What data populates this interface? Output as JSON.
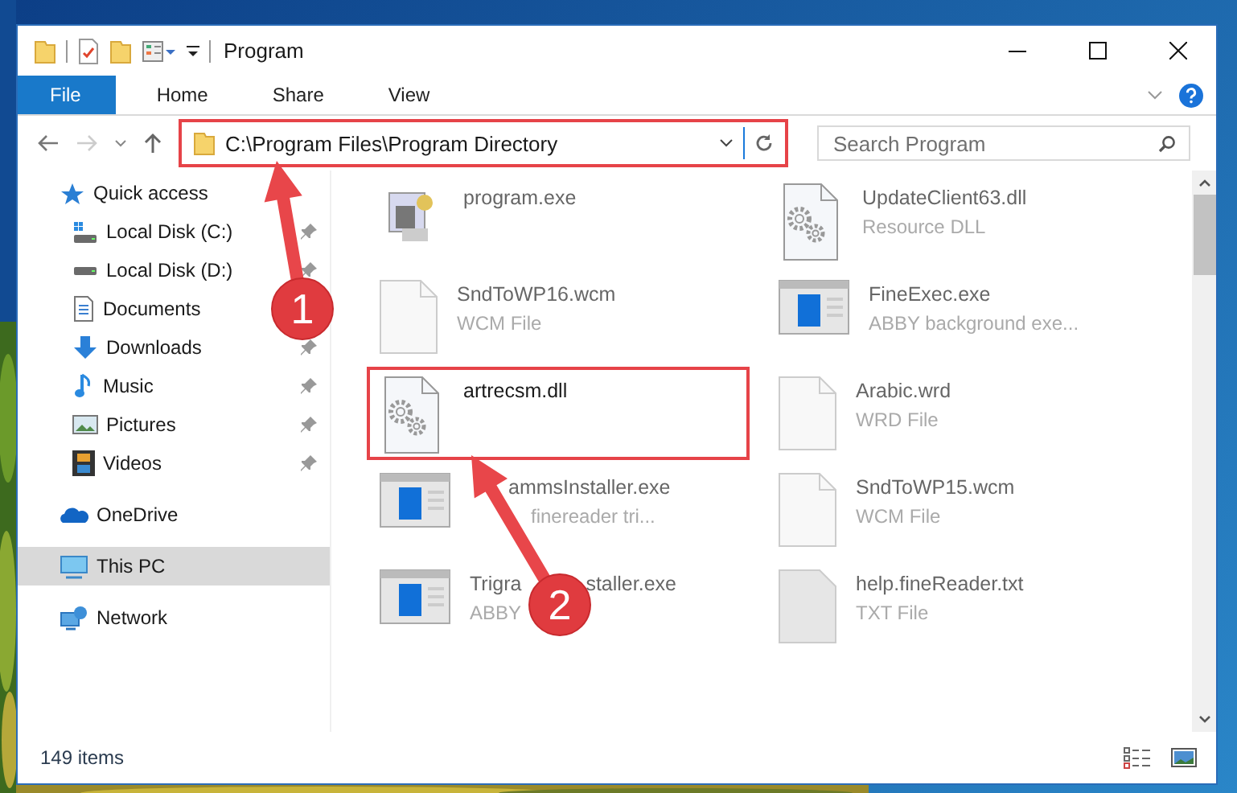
{
  "window": {
    "title": "Program"
  },
  "ribbon_tabs": [
    {
      "label": "File",
      "kind": "file",
      "selected": false
    },
    {
      "label": "Home",
      "kind": "tab",
      "selected": false
    },
    {
      "label": "Share",
      "kind": "tab",
      "selected": false
    },
    {
      "label": "View",
      "kind": "tab",
      "selected": false
    }
  ],
  "address": {
    "path": "C:\\Program Files\\Program Directory",
    "highlighted": true
  },
  "search": {
    "placeholder": "Search Program"
  },
  "sidebar": {
    "items": [
      {
        "label": "Quick access",
        "kind": "star",
        "selected": false,
        "children": [
          {
            "label": "Local Disk (C:)",
            "kind": "systemdrive",
            "pinned": true
          },
          {
            "label": "Local Disk (D:)",
            "kind": "drive",
            "pinned": true
          },
          {
            "label": "Documents",
            "kind": "document"
          },
          {
            "label": "Downloads",
            "kind": "download",
            "pinned": true
          },
          {
            "label": "Music",
            "kind": "music",
            "pinned": true
          },
          {
            "label": "Pictures",
            "kind": "pictures",
            "pinned": true
          },
          {
            "label": "Videos",
            "kind": "video",
            "pinned": true
          }
        ]
      },
      {
        "label": "OneDrive",
        "kind": "cloud",
        "selected": false
      },
      {
        "label": "This PC",
        "kind": "pc",
        "selected": true
      },
      {
        "label": "Network",
        "kind": "network",
        "selected": false
      }
    ]
  },
  "files": [
    {
      "name": "program.exe",
      "kind": "installer",
      "highlighted": false
    },
    {
      "name": "UpdateClient63.dll",
      "type": "Resource DLL",
      "kind": "dll",
      "highlighted": false
    },
    {
      "name": "SndToWP16.wcm",
      "type": "WCM File",
      "kind": "blank",
      "highlighted": false
    },
    {
      "name": "FineExec.exe",
      "type": "ABBY background exe...",
      "kind": "app",
      "highlighted": false
    },
    {
      "name": "artrecsm.dll",
      "kind": "dll",
      "highlighted": true
    },
    {
      "name": "Arabic.wrd",
      "type": "WRD File",
      "kind": "blank",
      "highlighted": false
    },
    {
      "name": "ammsInstaller.exe",
      "type": "finereader tri...",
      "kind": "app",
      "highlighted": false
    },
    {
      "name": "SndToWP15.wcm",
      "type": "WCM File",
      "kind": "blank",
      "highlighted": false
    },
    {
      "name": "Trigra",
      "name_tail": "staller.exe",
      "type": "ABBY",
      "kind": "app",
      "highlighted": false
    },
    {
      "name": "help.fineReader.txt",
      "type": "TXT File",
      "kind": "text",
      "highlighted": false
    }
  ],
  "callouts": [
    {
      "number": "1"
    },
    {
      "number": "2"
    }
  ],
  "status_bar": {
    "item_count": "149 items"
  }
}
